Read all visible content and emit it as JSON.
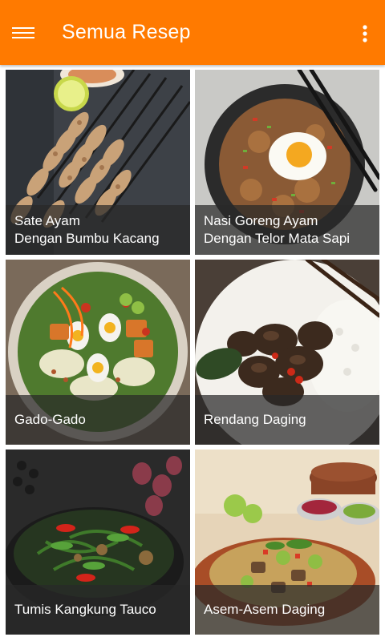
{
  "app_bar": {
    "title": "Semua Resep",
    "menu_icon": "hamburger-menu-icon",
    "overflow_icon": "more-vertical-icon",
    "color": "#ff7a00"
  },
  "recipes": [
    {
      "line1": "Sate Ayam",
      "line2": "Dengan Bumbu Kacang"
    },
    {
      "line1": "Nasi Goreng Ayam",
      "line2": "Dengan Telor Mata Sapi"
    },
    {
      "line1": "Gado-Gado",
      "line2": ""
    },
    {
      "line1": "Rendang Daging",
      "line2": ""
    },
    {
      "line1": "Tumis Kangkung Tauco",
      "line2": ""
    },
    {
      "line1": "Asem-Asem Daging",
      "line2": ""
    }
  ]
}
